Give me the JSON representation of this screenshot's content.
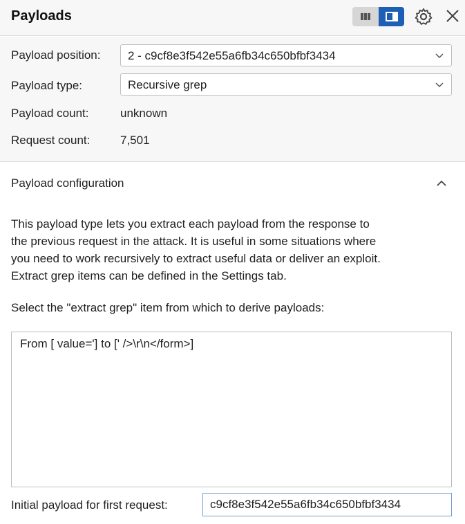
{
  "header": {
    "title": "Payloads",
    "layout_toggle": {
      "left_icon": "layout-columns-icon",
      "right_icon": "layout-sidepanel-icon",
      "selected": "right"
    },
    "settings_icon": "gear-icon",
    "close_icon": "close-icon",
    "accent_color": "#1c5fb5"
  },
  "settings": {
    "payload_position": {
      "label": "Payload position:",
      "value": "2 - c9cf8e3f542e55a6fb34c650bfbf3434"
    },
    "payload_type": {
      "label": "Payload type:",
      "value": "Recursive grep"
    },
    "payload_count": {
      "label": "Payload count:",
      "value": "unknown"
    },
    "request_count": {
      "label": "Request count:",
      "value": "7,501"
    }
  },
  "config": {
    "title": "Payload configuration",
    "description": [
      "This payload type lets you extract each payload from the response to",
      "the previous request in the attack. It is useful in some situations where",
      "you need to work recursively to extract useful data or deliver an exploit.",
      "Extract grep items can be defined in the Settings tab."
    ],
    "select_label": "Select the \"extract grep\" item from which to derive payloads:",
    "items": [
      "From [ value='] to [' />\\r\\n</form>]"
    ],
    "initial_payload": {
      "label": "Initial payload for first request:",
      "value": "c9cf8e3f542e55a6fb34c650bfbf3434"
    }
  }
}
